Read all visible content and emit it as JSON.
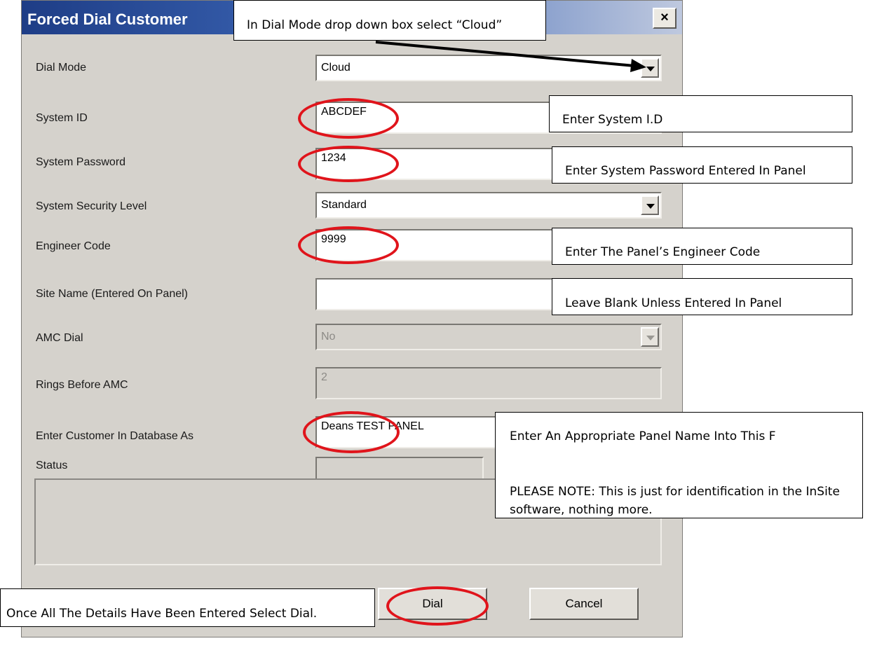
{
  "window": {
    "title": "Forced Dial Customer",
    "close_glyph": "×"
  },
  "form": {
    "dial_mode": {
      "label": "Dial Mode",
      "value": "Cloud"
    },
    "system_id": {
      "label": "System ID",
      "value": "ABCDEF"
    },
    "system_password": {
      "label": "System  Password",
      "value": "1234"
    },
    "security_level": {
      "label": "System Security Level",
      "value": "Standard"
    },
    "engineer_code": {
      "label": "Engineer Code",
      "value": "9999"
    },
    "site_name": {
      "label": "Site Name (Entered On Panel)",
      "value": ""
    },
    "amc_dial": {
      "label": "AMC Dial",
      "value": "No"
    },
    "rings_before_amc": {
      "label": "Rings Before AMC",
      "value": "2"
    },
    "customer_name": {
      "label": "Enter Customer In Database As",
      "value": "Deans TEST PANEL"
    },
    "status": {
      "label": "Status",
      "value": ""
    }
  },
  "buttons": {
    "dial": "Dial",
    "cancel": "Cancel"
  },
  "annotations": {
    "dial_mode": "In Dial Mode drop down box select “Cloud”",
    "system_id": "Enter System I.D",
    "password": "Enter System Password Entered In Panel",
    "engineer": "Enter The Panel’s Engineer Code",
    "site_name": "Leave Blank Unless Entered In Panel",
    "panel_name": "Enter An Appropriate Panel Name Into This F",
    "note": "PLEASE NOTE: This is just for identification in the InSite software, nothing more.",
    "dial": "Once All The Details Have Been Entered Select Dial."
  },
  "colors": {
    "highlight_circle": "#e0141b",
    "titlebar": "#1e3d86",
    "dialog_bg": "#d5d2cc"
  }
}
